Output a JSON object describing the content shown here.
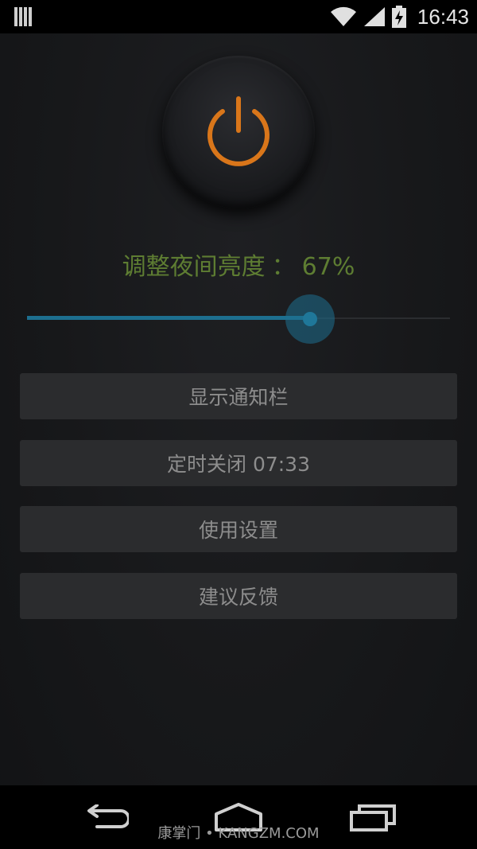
{
  "status_bar": {
    "time": "16:43",
    "left_icon": "notification-bars-icon",
    "icons": [
      "wifi-icon",
      "signal-icon",
      "battery-charging-icon"
    ]
  },
  "power": {
    "icon": "power-icon",
    "color": "#d9761a"
  },
  "brightness": {
    "label": "调整夜间亮度",
    "separator": "：",
    "value_text": "67%",
    "value": 0.67,
    "label_color": "#5e7d32"
  },
  "slider": {
    "value": 0.67,
    "accent": "#1d6f8f"
  },
  "menu": {
    "show_notification": "显示通知栏",
    "timer_close": "定时关闭 07:33",
    "usage_settings": "使用设置",
    "feedback": "建议反馈"
  },
  "nav": {
    "icons": [
      "back-icon",
      "home-icon",
      "recents-icon"
    ]
  },
  "watermark": "康掌门 • KANGZM.COM"
}
